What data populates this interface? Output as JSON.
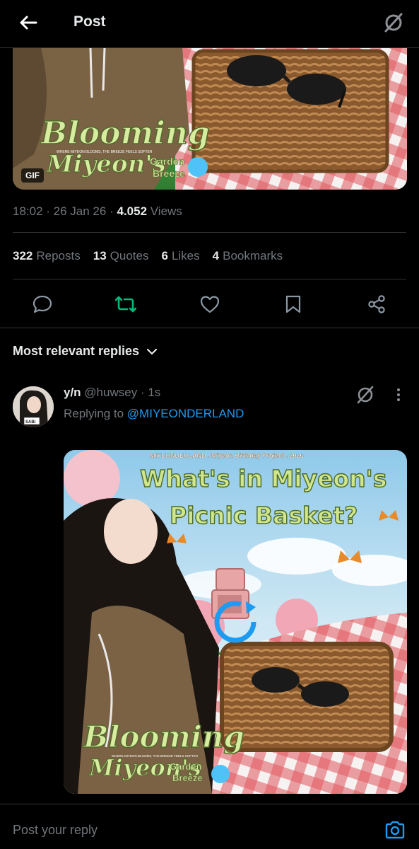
{
  "header": {
    "title": "Post",
    "back_icon": "arrow-left-icon",
    "grok_icon": "grok-icon"
  },
  "top_media": {
    "badge": "GIF",
    "title_line1": "Blooming",
    "title_line2": "Miyeon's",
    "title_garden": "Garden",
    "title_breeze": "Breeze",
    "tagline": "WHERE MIYEON BLOOMS, THE BREEZE FEELS SOFTER"
  },
  "meta": {
    "time": "18:02",
    "date": "26 Jan 26",
    "views_count": "4.052",
    "views_label": "Views"
  },
  "stats": [
    {
      "count": "322",
      "label": "Reposts"
    },
    {
      "count": "13",
      "label": "Quotes"
    },
    {
      "count": "6",
      "label": "Likes"
    },
    {
      "count": "4",
      "label": "Bookmarks"
    }
  ],
  "actions": [
    {
      "name": "reply",
      "icon": "comment-icon"
    },
    {
      "name": "repost",
      "icon": "repost-icon",
      "color": "#00ba7c"
    },
    {
      "name": "like",
      "icon": "heart-icon"
    },
    {
      "name": "bookmark",
      "icon": "bookmark-icon"
    },
    {
      "name": "share",
      "icon": "share-icon"
    }
  ],
  "replies_filter": {
    "label": "Most relevant replies"
  },
  "reply": {
    "name": "y/n",
    "handle": "@huwsey",
    "time": "· 1s",
    "replying_prefix": "Replying to",
    "replying_handle": "@MIYEONDERLAND",
    "avatar_tag": "SABi",
    "media": {
      "banner": "MIYEONDERLAND . Miyeon Birthday Project . 2026",
      "headline1": "What's in Miyeon's",
      "headline2": "Picnic Basket?",
      "title_line1": "Blooming",
      "title_line2": "Miyeon's",
      "title_garden": "Garden",
      "title_breeze": "Breeze",
      "tagline": "WHERE MIYEON BLOOMS, THE BREEZE FEELS SOFTER"
    }
  },
  "composer": {
    "placeholder": "Post your reply",
    "camera_icon": "camera-icon"
  },
  "colors": {
    "accent": "#1d9bf0",
    "repost": "#00ba7c",
    "muted": "#71767b",
    "text": "#e7e9ea",
    "border": "#2f3336"
  }
}
